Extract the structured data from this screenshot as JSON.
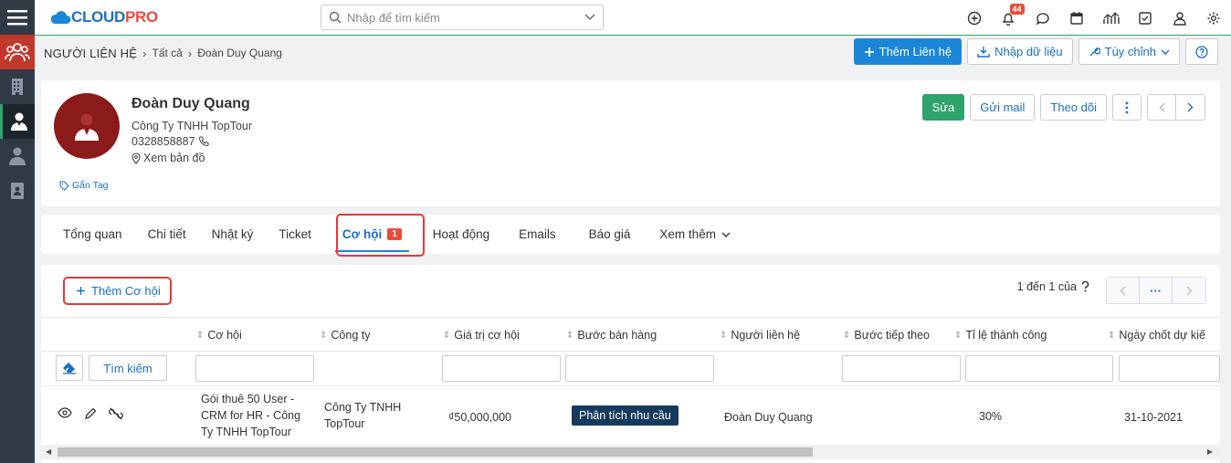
{
  "app": {
    "logo_main": "CLOUD",
    "logo_accent": "PRO",
    "search_placeholder": "Nhập để tìm kiếm",
    "notification_count": "44"
  },
  "breadcrumb": {
    "root": "NGƯỜI LIÊN HỆ",
    "level1": "Tất cả",
    "level2": "Đoàn Duy Quang"
  },
  "header_actions": {
    "add_contact": "Thêm Liên hệ",
    "import": "Nhập dữ liệu",
    "customize": "Tùy chỉnh"
  },
  "profile": {
    "name": "Đoàn Duy Quang",
    "company": "Công Ty TNHH TopTour",
    "phone": "0328858887",
    "map": "Xem bản đồ",
    "tag": "Gắn Tag",
    "edit": "Sửa",
    "send_mail": "Gửi mail",
    "follow": "Theo dõi"
  },
  "tabs": [
    {
      "label": "Tổng quan"
    },
    {
      "label": "Chi tiết"
    },
    {
      "label": "Nhật ký"
    },
    {
      "label": "Ticket"
    },
    {
      "label": "Cơ hội",
      "badge": "1"
    },
    {
      "label": "Hoạt động"
    },
    {
      "label": "Emails"
    },
    {
      "label": "Báo giá"
    },
    {
      "label": "Xem thêm"
    }
  ],
  "opportunities": {
    "add_label": "Thêm Cơ hội",
    "pager_text": "1 đến 1 của",
    "pager_more": "···",
    "search_button": "Tìm kiếm",
    "columns": [
      "Cơ hội",
      "Công ty",
      "Giá trị cơ hội",
      "Bước bán hàng",
      "Người liên hệ",
      "Bước tiếp theo",
      "Tỉ lệ thành công",
      "Ngày chốt dự kiế"
    ],
    "rows": [
      {
        "name": "Gói thuê 50 User - CRM for HR - Công Ty TNHH TopTour",
        "company": "Công Ty TNHH TopTour",
        "value": "₫50,000,000",
        "stage": "Phân tích nhu cầu",
        "contact": "Đoàn Duy Quang",
        "next_step": "",
        "probability": "30%",
        "close_date": "31-10-2021"
      }
    ]
  },
  "colors": {
    "rail": "#2f3a45",
    "primary": "#1b86d6",
    "green": "#2ea36b",
    "highlight": "#e53935",
    "stage_badge": "#163a5f"
  }
}
